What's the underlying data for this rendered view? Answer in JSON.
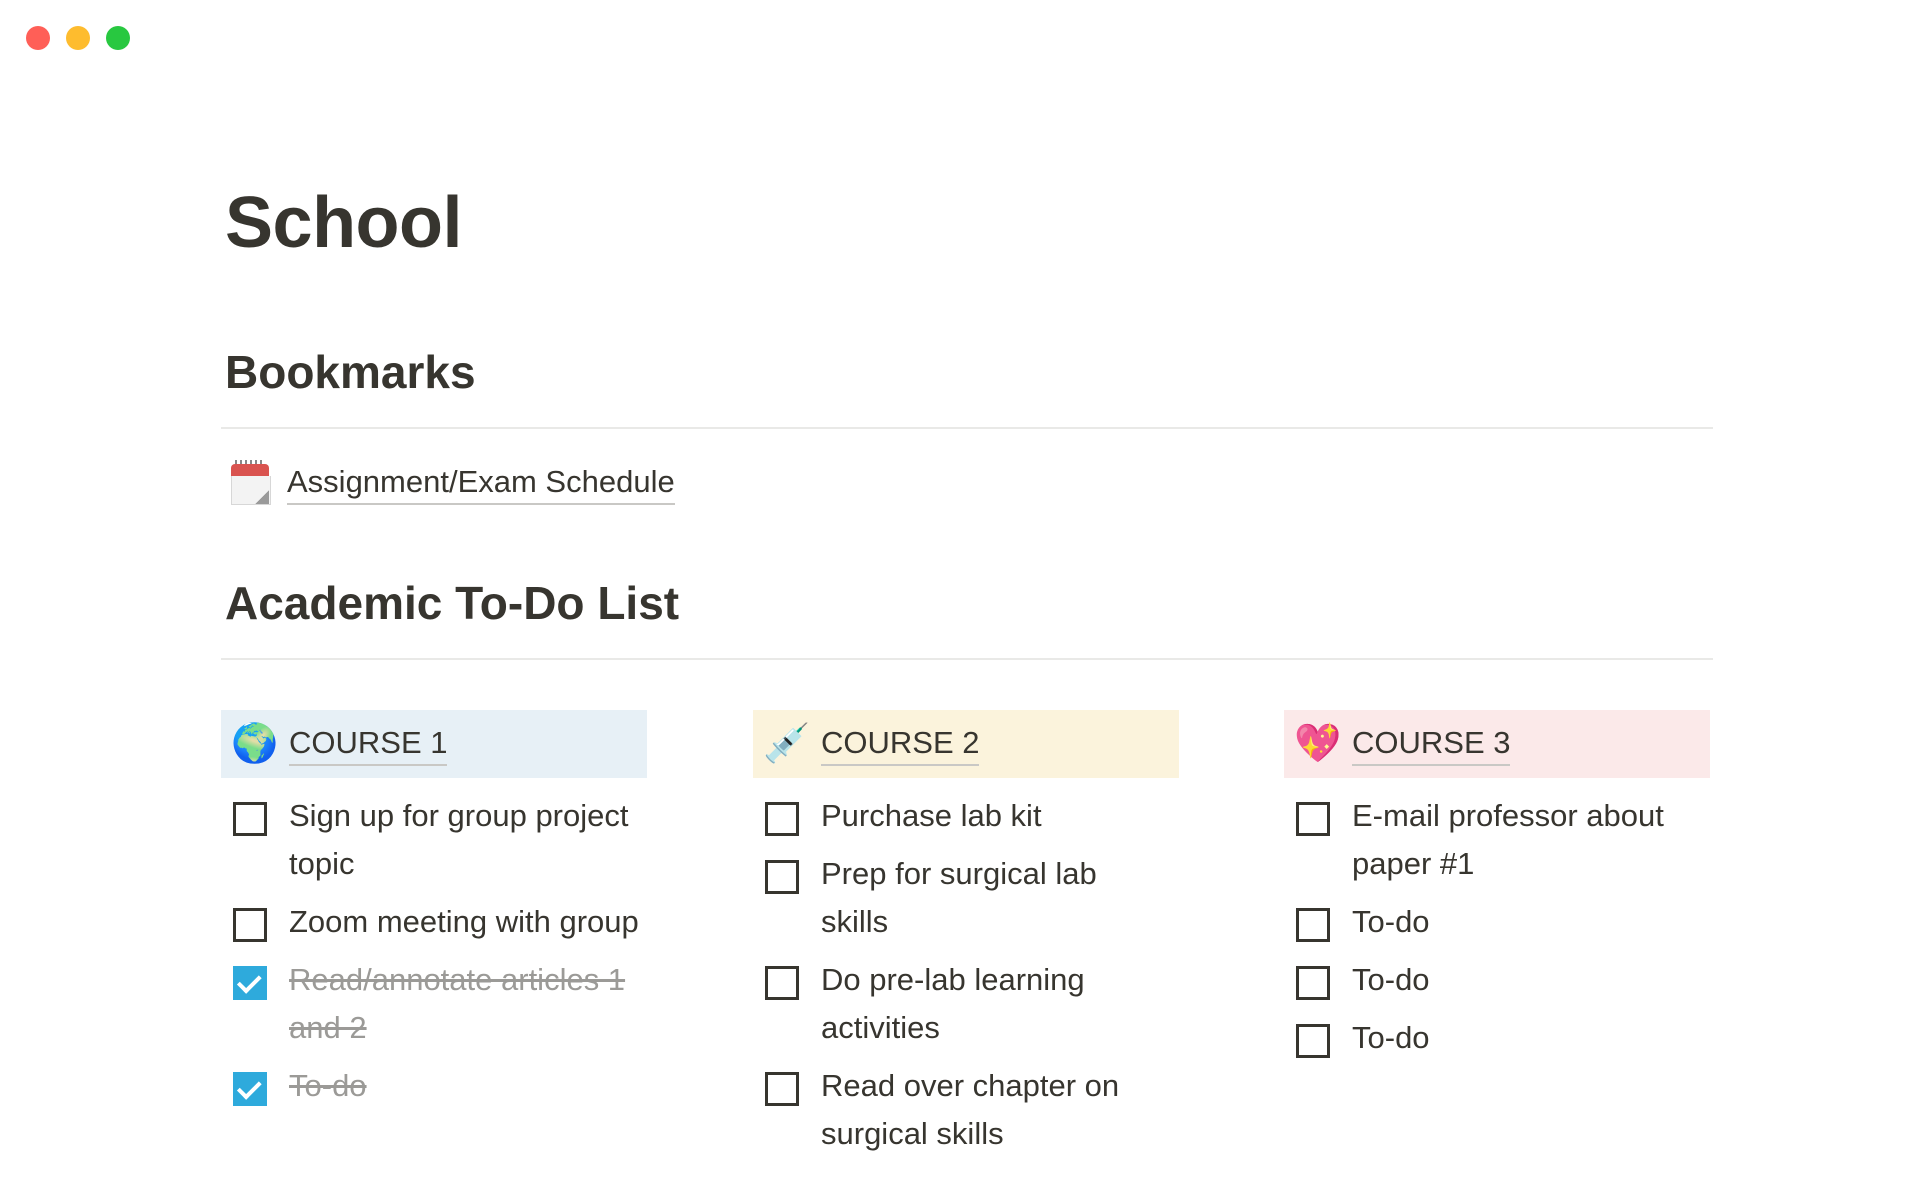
{
  "page": {
    "title": "School"
  },
  "bookmarks": {
    "heading": "Bookmarks",
    "items": [
      {
        "icon": "calendar-icon",
        "label": "Assignment/Exam Schedule"
      }
    ]
  },
  "todo": {
    "heading": "Academic To-Do List",
    "courses": [
      {
        "label": "COURSE 1",
        "icon": "globe-icon",
        "emoji": "🌍",
        "color": "#e7f0f6",
        "items": [
          {
            "text": "Sign up for group project topic",
            "checked": false
          },
          {
            "text": "Zoom meeting with group",
            "checked": false
          },
          {
            "text": "Read/annotate articles 1 and 2",
            "checked": true
          },
          {
            "text": "To-do",
            "checked": true
          }
        ]
      },
      {
        "label": "COURSE 2",
        "icon": "syringe-icon",
        "emoji": "💉",
        "color": "#fbf3dc",
        "items": [
          {
            "text": "Purchase lab kit",
            "checked": false
          },
          {
            "text": "Prep for surgical lab skills",
            "checked": false
          },
          {
            "text": "Do pre-lab learning activities",
            "checked": false
          },
          {
            "text": "Read over chapter on surgical skills",
            "checked": false
          }
        ]
      },
      {
        "label": "COURSE 3",
        "icon": "sparkling-heart-icon",
        "emoji": "💖",
        "color": "#fbe9e9",
        "items": [
          {
            "text": "E-mail professor about paper #1",
            "checked": false
          },
          {
            "text": "To-do",
            "checked": false
          },
          {
            "text": "To-do",
            "checked": false
          },
          {
            "text": "To-do",
            "checked": false
          }
        ]
      }
    ]
  },
  "colors": {
    "text": "#37352f",
    "checked": "#2eaadc",
    "done_text": "#9b9a97"
  }
}
